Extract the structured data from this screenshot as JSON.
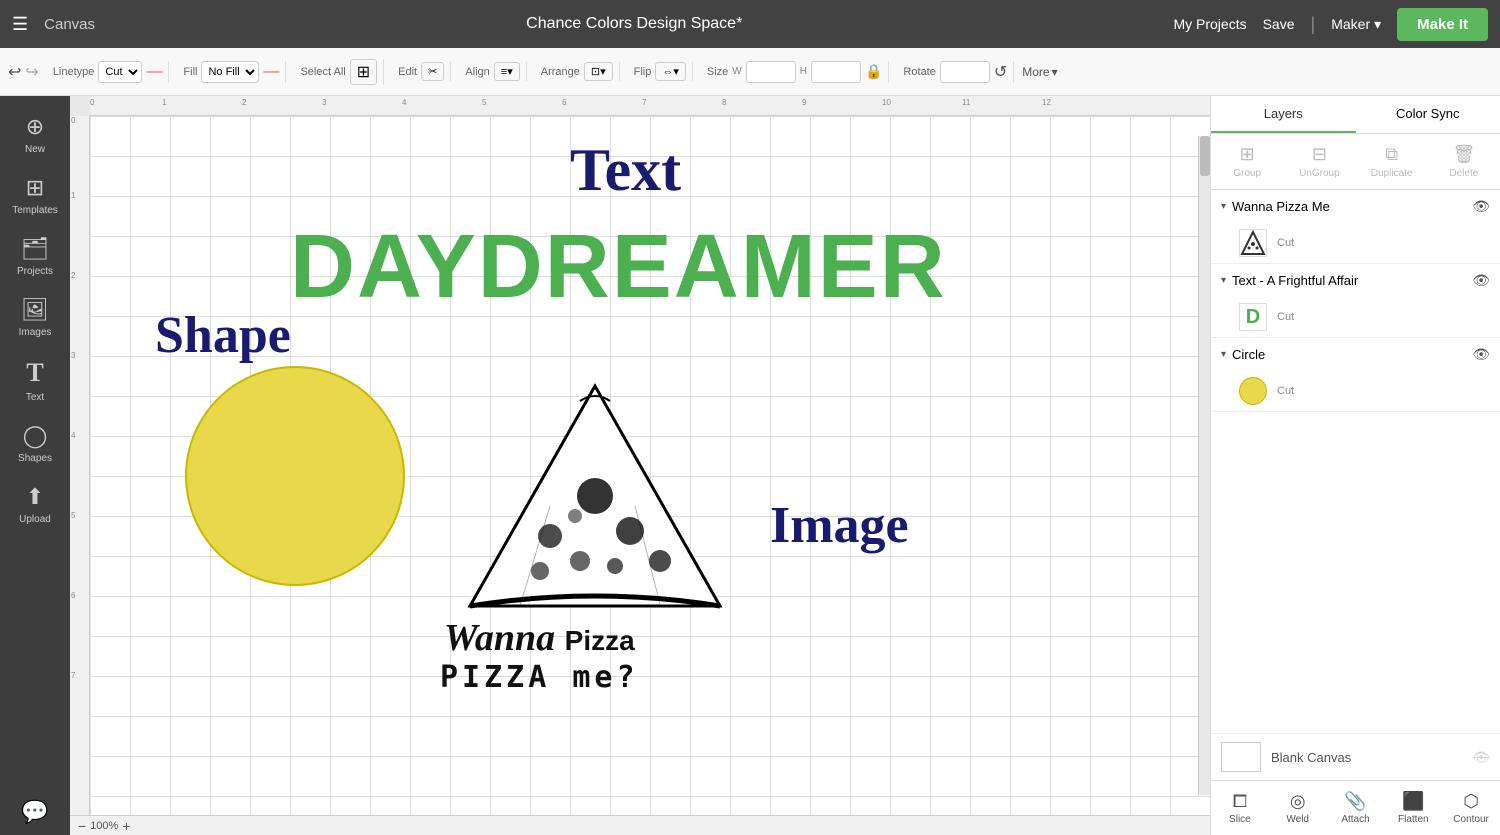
{
  "topNav": {
    "hamburger": "☰",
    "appName": "Canvas",
    "title": "Chance Colors Design Space*",
    "myProjects": "My Projects",
    "save": "Save",
    "divider": "|",
    "maker": "Maker",
    "makeIt": "Make It"
  },
  "toolbar": {
    "linetypeLabel": "Linetype",
    "linetypeValue": "Cut",
    "fillLabel": "Fill",
    "fillValue": "No Fill",
    "selectAllLabel": "Select All",
    "editLabel": "Edit",
    "alignLabel": "Align",
    "arrangeLabel": "Arrange",
    "flipLabel": "Flip",
    "sizeLabel": "Size",
    "wLabel": "W",
    "hLabel": "H",
    "rotateLabel": "Rotate",
    "more": "More"
  },
  "sidebar": {
    "items": [
      {
        "id": "new",
        "label": "New",
        "icon": "＋"
      },
      {
        "id": "templates",
        "label": "Templates",
        "icon": "⊞"
      },
      {
        "id": "projects",
        "label": "Projects",
        "icon": "🗂"
      },
      {
        "id": "images",
        "label": "Images",
        "icon": "🖼"
      },
      {
        "id": "text",
        "label": "Text",
        "icon": "T"
      },
      {
        "id": "shapes",
        "label": "Shapes",
        "icon": "◯"
      },
      {
        "id": "upload",
        "label": "Upload",
        "icon": "⬆"
      }
    ]
  },
  "canvas": {
    "zoomValue": "100%",
    "textLabel": "Text",
    "daydreamer": "DAYDREAMER",
    "shapeLabel": "Shape",
    "imageLabel": "Image",
    "wannaScript": "Wanna",
    "pizzaLine1": "PIZZA",
    "pizzaLine2": "me?"
  },
  "rightPanel": {
    "tabs": [
      {
        "id": "layers",
        "label": "Layers",
        "active": true
      },
      {
        "id": "colorSync",
        "label": "Color Sync",
        "active": false
      }
    ],
    "actions": [
      {
        "id": "group",
        "label": "Group",
        "icon": "⊞"
      },
      {
        "id": "ungroup",
        "label": "UnGroup",
        "icon": "⊟"
      },
      {
        "id": "duplicate",
        "label": "Duplicate",
        "icon": "⧉"
      },
      {
        "id": "delete",
        "label": "Delete",
        "icon": "🗑"
      }
    ],
    "layers": [
      {
        "id": "wanna-pizza-me",
        "groupName": "Wanna Pizza Me",
        "visible": true,
        "items": [
          {
            "id": "pizza-cut",
            "type": "image",
            "label": "Cut",
            "thumbColor": "#fff"
          }
        ]
      },
      {
        "id": "text-frightful",
        "groupName": "Text - A Frightful Affair",
        "visible": true,
        "items": [
          {
            "id": "text-d-cut",
            "type": "text",
            "label": "Cut",
            "thumbChar": "D",
            "thumbColor": "#4CAF50"
          }
        ]
      },
      {
        "id": "circle-group",
        "groupName": "Circle",
        "visible": true,
        "items": [
          {
            "id": "circle-cut",
            "type": "circle",
            "label": "Cut",
            "thumbColor": "#e8d84a"
          }
        ]
      }
    ],
    "blankCanvas": {
      "label": "Blank Canvas",
      "visible": false
    },
    "bottomActions": [
      {
        "id": "slice",
        "label": "Slice",
        "icon": "⧠"
      },
      {
        "id": "weld",
        "label": "Weld",
        "icon": "◎"
      },
      {
        "id": "attach",
        "label": "Attach",
        "icon": "📎"
      },
      {
        "id": "flatten",
        "label": "Flatten",
        "icon": "⬛"
      },
      {
        "id": "contour",
        "label": "Contour",
        "icon": "⬡"
      }
    ]
  },
  "statusBar": {
    "chatIcon": "💬"
  }
}
